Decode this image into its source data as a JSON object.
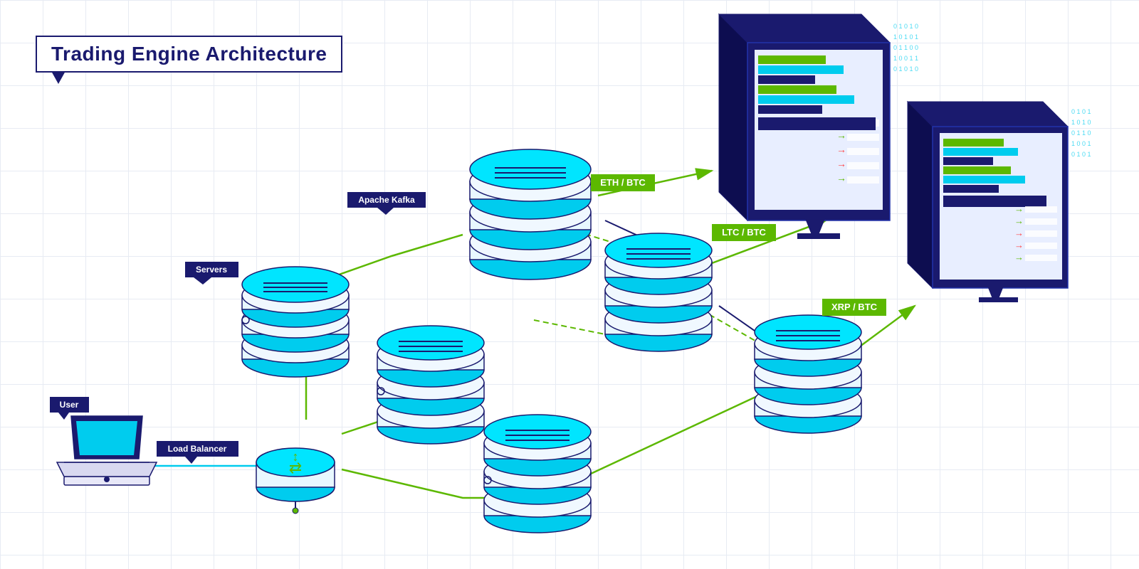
{
  "title": "Trading Engine Architecture",
  "labels": {
    "user": "User",
    "servers": "Servers",
    "load_balancer": "Load Balancer",
    "apache_kafka": "Apache Kafka",
    "eth_btc": "ETH / BTC",
    "ltc_btc": "LTC / BTC",
    "xrp_btc": "XRP / BTC"
  },
  "colors": {
    "navy": "#1a1a6e",
    "green": "#5cb800",
    "cyan": "#00e5ff",
    "cyan_dark": "#00b8cc",
    "white": "#ffffff",
    "grid": "#d0d8e8",
    "dashed_green": "#5cb800"
  }
}
